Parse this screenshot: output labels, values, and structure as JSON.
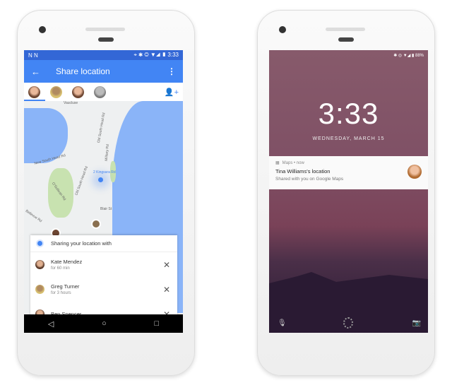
{
  "left_phone": {
    "status": {
      "left": "N N",
      "right": "⌖ ✱ ◎ ▼◢ ▮ 3:33"
    },
    "appbar": {
      "back_icon": "arrow-left-icon",
      "title": "Share location",
      "menu_icon": "more-vert-icon"
    },
    "contacts_icon": "add-person-icon",
    "map_labels": [
      "Vaucluse",
      "Old South Head Rd",
      "Military Rd",
      "New South Head Rd",
      "2 Kingsara Rd",
      "O'Sullivan Rd",
      "Old South Head Rd",
      "Bellevue Rd",
      "Blair St"
    ],
    "sheet": {
      "title": "Sharing your location with",
      "people": [
        {
          "name": "Kate Mendez",
          "duration": "for 60 min"
        },
        {
          "name": "Greg Turner",
          "duration": "for 3 hours"
        },
        {
          "name": "Ben Spencer",
          "duration": ""
        }
      ]
    },
    "nav": {
      "back": "◁",
      "home": "○",
      "recents": "□"
    }
  },
  "right_phone": {
    "status": "✱ ◎ ▼◢ ▮ 88%",
    "time": "3:33",
    "date": "WEDNESDAY, MARCH 15",
    "notification": {
      "app": "Maps • now",
      "title": "Tina Williams's location",
      "text": "Shared with you on Google Maps"
    }
  },
  "colors": {
    "primary": "#4285f4",
    "status": "#3367d6",
    "lock_bg": "#875a6b"
  }
}
